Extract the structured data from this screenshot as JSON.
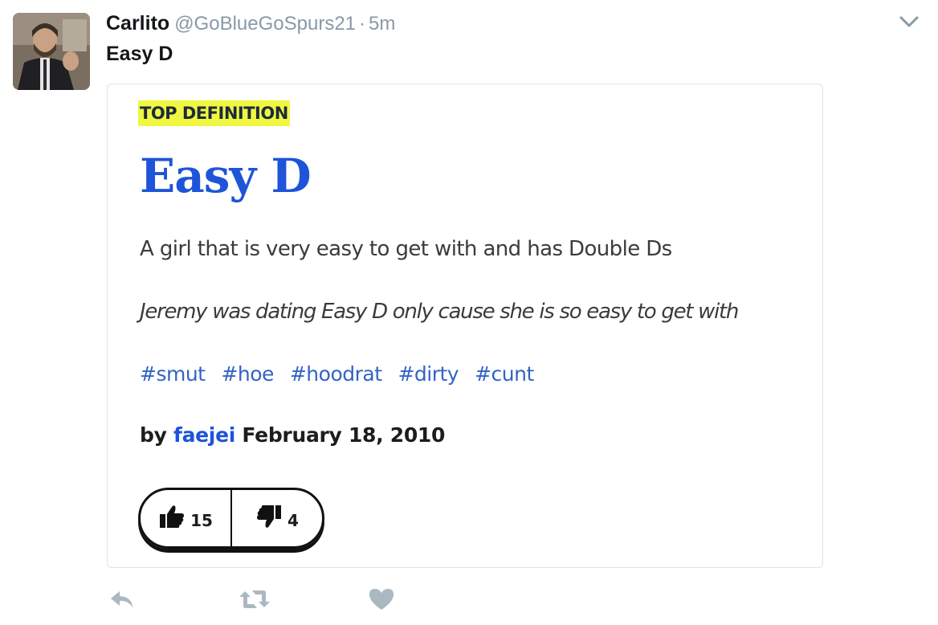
{
  "tweet": {
    "display_name": "Carlito",
    "handle": "@GoBlueGoSpurs21",
    "separator": "·",
    "time": "5m",
    "text": "Easy D"
  },
  "card": {
    "badge": "TOP DEFINITION",
    "word": "Easy D",
    "meaning": "A girl that is very easy to get with and has Double Ds",
    "example": "Jeremy was dating Easy D only cause she is so easy to get with",
    "tags": [
      "#smut",
      "#hoe",
      "#hoodrat",
      "#dirty",
      "#cunt"
    ],
    "byline": {
      "prefix": "by",
      "author": "faejei",
      "date": "February 18, 2010"
    },
    "votes": {
      "up": "15",
      "down": "4"
    }
  },
  "icons": {
    "menu": "chevron-down-icon",
    "upvote": "thumbs-up-icon",
    "downvote": "thumbs-down-icon",
    "reply": "reply-icon",
    "retweet": "retweet-icon",
    "like": "heart-icon"
  },
  "colors": {
    "word_link": "#1e54d8",
    "tag_link": "#3363c5",
    "highlight": "#eff740",
    "muted": "#8899a6",
    "action_icon": "#aab8c2"
  }
}
